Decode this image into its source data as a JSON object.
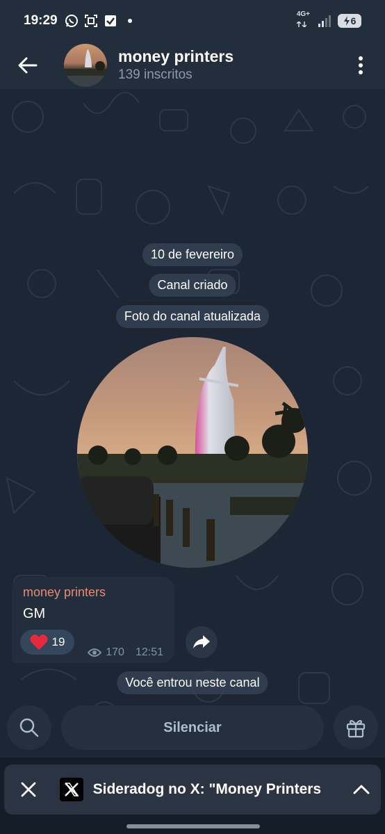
{
  "status_bar": {
    "time": "19:29",
    "icons_left": [
      "whatsapp-icon",
      "screenshot-icon",
      "check-icon",
      "dot-icon"
    ],
    "network": "4G+",
    "battery": "6"
  },
  "header": {
    "title": "money printers",
    "subtitle": "139 inscritos"
  },
  "chat": {
    "date_label": "10 de fevereiro",
    "service_created": "Canal criado",
    "service_photo": "Foto do canal atualizada",
    "message": {
      "author": "money printers",
      "text": "GM",
      "reaction_emoji": "heart",
      "reaction_count": "19",
      "views": "170",
      "time": "12:51"
    },
    "joined_label": "Você entrou neste canal"
  },
  "bottom_bar": {
    "mute_label": "Silenciar"
  },
  "notification": {
    "text": "Sideradog no X: \"Money Printers"
  },
  "colors": {
    "background": "#1c2634",
    "header": "#232e3c",
    "author": "#e88a78",
    "reaction": "#33465c"
  }
}
